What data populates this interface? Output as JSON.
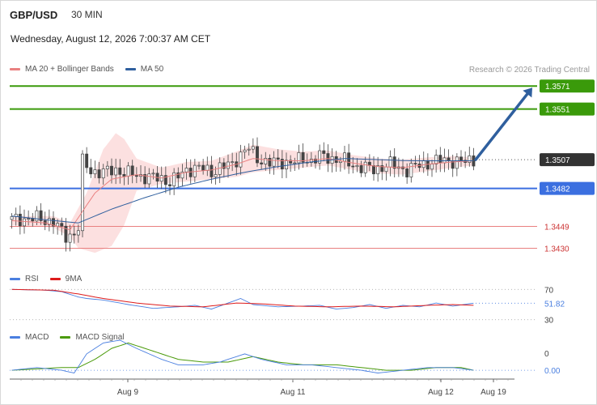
{
  "header": {
    "symbol": "GBP/USD",
    "timeframe": "30 MIN",
    "datetime": "Wednesday, August 12, 2026 7:00:37 AM CET",
    "credit": "Research © 2026 Trading Central"
  },
  "colors": {
    "resistance": "#3a9a0a",
    "pivot": "#3b6fe0",
    "support": "#e98080",
    "price_tag": "#333333",
    "arrow": "#2f5f9e",
    "ma20": "#e98080",
    "ma50": "#2f5f9e",
    "rsi": "#4a7fe0",
    "rsi_ma": "#dd1b1b",
    "macd": "#4a7fe0",
    "macd_signal": "#4a9a0a"
  },
  "chart_data": [
    {
      "type": "candlestick",
      "title": "GBP/USD",
      "legend": [
        {
          "name": "MA 20 + Bollinger Bands",
          "color": "#e98080"
        },
        {
          "name": "MA 50",
          "color": "#2f5f9e"
        }
      ],
      "ylim": [
        1.3412,
        1.3581
      ],
      "last_price": "1.3507",
      "levels": [
        {
          "label": "1.3571",
          "value": 1.3571,
          "kind": "resistance"
        },
        {
          "label": "1.3551",
          "value": 1.3551,
          "kind": "resistance"
        },
        {
          "label": "1.3482",
          "value": 1.3482,
          "kind": "pivot"
        },
        {
          "label": "1.3449",
          "value": 1.3449,
          "kind": "support"
        },
        {
          "label": "1.3430",
          "value": 1.343,
          "kind": "support"
        }
      ],
      "forecast_arrow": {
        "from": 1.3507,
        "to": 1.3571,
        "direction": "up"
      },
      "x_ticks": [
        "Aug 9",
        "Aug 11",
        "Aug 12",
        "Aug 19"
      ],
      "close_path": [
        [
          0,
          1.3455
        ],
        [
          6,
          1.3456
        ],
        [
          10,
          1.3453
        ],
        [
          13,
          1.344
        ],
        [
          15,
          1.3443
        ],
        [
          16,
          1.3448
        ],
        [
          17,
          1.3505
        ],
        [
          19,
          1.3497
        ],
        [
          22,
          1.3496
        ],
        [
          25,
          1.3498
        ],
        [
          28,
          1.3495
        ],
        [
          30,
          1.3493
        ],
        [
          33,
          1.3492
        ],
        [
          36,
          1.349
        ],
        [
          38,
          1.3488
        ],
        [
          40,
          1.3492
        ],
        [
          42,
          1.3498
        ],
        [
          44,
          1.35
        ],
        [
          46,
          1.3499
        ],
        [
          48,
          1.3496
        ],
        [
          50,
          1.35
        ],
        [
          53,
          1.3503
        ],
        [
          55,
          1.3512
        ],
        [
          57,
          1.3517
        ],
        [
          59,
          1.3508
        ],
        [
          62,
          1.3504
        ],
        [
          65,
          1.3505
        ],
        [
          68,
          1.3505
        ],
        [
          70,
          1.3508
        ],
        [
          72,
          1.3506
        ],
        [
          74,
          1.351
        ],
        [
          77,
          1.3508
        ],
        [
          80,
          1.3506
        ],
        [
          82,
          1.3502
        ],
        [
          85,
          1.35
        ],
        [
          87,
          1.3498
        ],
        [
          89,
          1.3501
        ],
        [
          91,
          1.3503
        ],
        [
          93,
          1.35
        ],
        [
          95,
          1.3498
        ],
        [
          97,
          1.3501
        ],
        [
          99,
          1.3503
        ],
        [
          101,
          1.3505
        ],
        [
          103,
          1.3506
        ],
        [
          106,
          1.3506
        ],
        [
          109,
          1.3505
        ],
        [
          111,
          1.3507
        ]
      ],
      "ma20_path": [
        [
          0,
          1.3454
        ],
        [
          8,
          1.3452
        ],
        [
          14,
          1.3446
        ],
        [
          17,
          1.3462
        ],
        [
          20,
          1.3478
        ],
        [
          24,
          1.349
        ],
        [
          30,
          1.3494
        ],
        [
          36,
          1.3491
        ],
        [
          42,
          1.3496
        ],
        [
          48,
          1.3498
        ],
        [
          54,
          1.3503
        ],
        [
          58,
          1.3508
        ],
        [
          64,
          1.3506
        ],
        [
          70,
          1.3506
        ],
        [
          76,
          1.3508
        ],
        [
          82,
          1.3504
        ],
        [
          88,
          1.3501
        ],
        [
          94,
          1.35
        ],
        [
          100,
          1.3503
        ],
        [
          106,
          1.3505
        ],
        [
          111,
          1.3506
        ]
      ],
      "bb_upper": [
        [
          0,
          1.3458
        ],
        [
          10,
          1.3458
        ],
        [
          14,
          1.3452
        ],
        [
          18,
          1.3478
        ],
        [
          22,
          1.3516
        ],
        [
          25,
          1.353
        ],
        [
          27,
          1.3525
        ],
        [
          30,
          1.3508
        ],
        [
          36,
          1.35
        ],
        [
          42,
          1.3505
        ],
        [
          48,
          1.3506
        ],
        [
          54,
          1.3514
        ],
        [
          58,
          1.352
        ],
        [
          64,
          1.3516
        ],
        [
          70,
          1.3514
        ],
        [
          76,
          1.3515
        ],
        [
          82,
          1.3511
        ],
        [
          88,
          1.3508
        ],
        [
          94,
          1.3507
        ],
        [
          100,
          1.3509
        ],
        [
          106,
          1.351
        ],
        [
          111,
          1.3509
        ]
      ],
      "bb_lower": [
        [
          0,
          1.345
        ],
        [
          10,
          1.3448
        ],
        [
          14,
          1.344
        ],
        [
          16,
          1.343
        ],
        [
          20,
          1.3426
        ],
        [
          24,
          1.3432
        ],
        [
          27,
          1.345
        ],
        [
          30,
          1.348
        ],
        [
          36,
          1.3486
        ],
        [
          42,
          1.3488
        ],
        [
          48,
          1.349
        ],
        [
          54,
          1.3492
        ],
        [
          58,
          1.3496
        ],
        [
          64,
          1.3498
        ],
        [
          70,
          1.35
        ],
        [
          76,
          1.3502
        ],
        [
          82,
          1.3498
        ],
        [
          88,
          1.3495
        ],
        [
          94,
          1.3494
        ],
        [
          100,
          1.3497
        ],
        [
          106,
          1.35
        ],
        [
          111,
          1.3502
        ]
      ],
      "ma50_path": [
        [
          0,
          1.3458
        ],
        [
          10,
          1.3454
        ],
        [
          16,
          1.3452
        ],
        [
          24,
          1.3464
        ],
        [
          32,
          1.3474
        ],
        [
          40,
          1.3483
        ],
        [
          48,
          1.349
        ],
        [
          56,
          1.3496
        ],
        [
          64,
          1.3501
        ],
        [
          72,
          1.3505
        ],
        [
          80,
          1.3508
        ],
        [
          88,
          1.3507
        ],
        [
          96,
          1.3506
        ],
        [
          104,
          1.3506
        ],
        [
          111,
          1.3506
        ]
      ]
    },
    {
      "type": "line",
      "title": "RSI",
      "legend": [
        {
          "name": "RSI",
          "color": "#4a7fe0"
        },
        {
          "name": "9MA",
          "color": "#dd1b1b"
        }
      ],
      "ylim": [
        20,
        80
      ],
      "reference_lines": [
        70,
        30
      ],
      "y_labels": [
        "70",
        "30"
      ],
      "last_value_label": "51.82",
      "series": [
        {
          "name": "RSI",
          "points": [
            [
              0,
              70
            ],
            [
              8,
              69
            ],
            [
              12,
              67
            ],
            [
              16,
              60
            ],
            [
              18,
              58
            ],
            [
              22,
              56
            ],
            [
              28,
              50
            ],
            [
              34,
              45
            ],
            [
              40,
              47
            ],
            [
              44,
              49
            ],
            [
              48,
              44
            ],
            [
              52,
              52
            ],
            [
              55,
              58
            ],
            [
              58,
              50
            ],
            [
              64,
              47
            ],
            [
              70,
              48
            ],
            [
              74,
              49
            ],
            [
              78,
              44
            ],
            [
              82,
              46
            ],
            [
              86,
              50
            ],
            [
              90,
              45
            ],
            [
              94,
              49
            ],
            [
              98,
              47
            ],
            [
              102,
              52
            ],
            [
              106,
              48
            ],
            [
              111,
              51.82
            ]
          ]
        },
        {
          "name": "9MA",
          "points": [
            [
              0,
              70
            ],
            [
              10,
              69
            ],
            [
              16,
              64
            ],
            [
              22,
              58
            ],
            [
              30,
              52
            ],
            [
              38,
              48
            ],
            [
              46,
              47
            ],
            [
              54,
              52
            ],
            [
              60,
              51
            ],
            [
              68,
              48
            ],
            [
              76,
              47
            ],
            [
              84,
              48
            ],
            [
              92,
              47
            ],
            [
              100,
              49
            ],
            [
              106,
              50
            ],
            [
              111,
              49
            ]
          ]
        }
      ]
    },
    {
      "type": "line",
      "title": "MACD",
      "legend": [
        {
          "name": "MACD",
          "color": "#4a7fe0"
        },
        {
          "name": "MACD Signal",
          "color": "#4a9a0a"
        }
      ],
      "ylim": [
        -0.0005,
        0.0011
      ],
      "reference_lines": [
        0
      ],
      "y_labels": [
        "0"
      ],
      "last_value_label": "0.00",
      "series": [
        {
          "name": "MACD",
          "points": [
            [
              0,
              0.0
            ],
            [
              6,
              0.0001
            ],
            [
              12,
              0.0
            ],
            [
              15,
              -0.0001
            ],
            [
              18,
              0.0006
            ],
            [
              22,
              0.001
            ],
            [
              26,
              0.0011
            ],
            [
              30,
              0.0008
            ],
            [
              36,
              0.0004
            ],
            [
              40,
              0.0002
            ],
            [
              46,
              0.0002
            ],
            [
              50,
              0.0003
            ],
            [
              54,
              0.0005
            ],
            [
              56,
              0.0006
            ],
            [
              60,
              0.0004
            ],
            [
              66,
              0.0002
            ],
            [
              72,
              0.0002
            ],
            [
              78,
              0.0001
            ],
            [
              84,
              0.0
            ],
            [
              88,
              -0.0001
            ],
            [
              94,
              0.0
            ],
            [
              100,
              0.0001
            ],
            [
              106,
              0.0001
            ],
            [
              111,
              0.0
            ]
          ]
        },
        {
          "name": "MACD Signal",
          "points": [
            [
              0,
              0.0
            ],
            [
              12,
              0.0001
            ],
            [
              16,
              0.0001
            ],
            [
              20,
              0.0004
            ],
            [
              24,
              0.0008
            ],
            [
              28,
              0.001
            ],
            [
              34,
              0.0007
            ],
            [
              40,
              0.0004
            ],
            [
              46,
              0.0003
            ],
            [
              52,
              0.0003
            ],
            [
              58,
              0.0005
            ],
            [
              64,
              0.0003
            ],
            [
              70,
              0.0002
            ],
            [
              78,
              0.0002
            ],
            [
              84,
              0.0001
            ],
            [
              90,
              0.0
            ],
            [
              96,
              0.0
            ],
            [
              102,
              0.0001
            ],
            [
              108,
              0.0001
            ],
            [
              111,
              0.0
            ]
          ]
        }
      ]
    }
  ]
}
